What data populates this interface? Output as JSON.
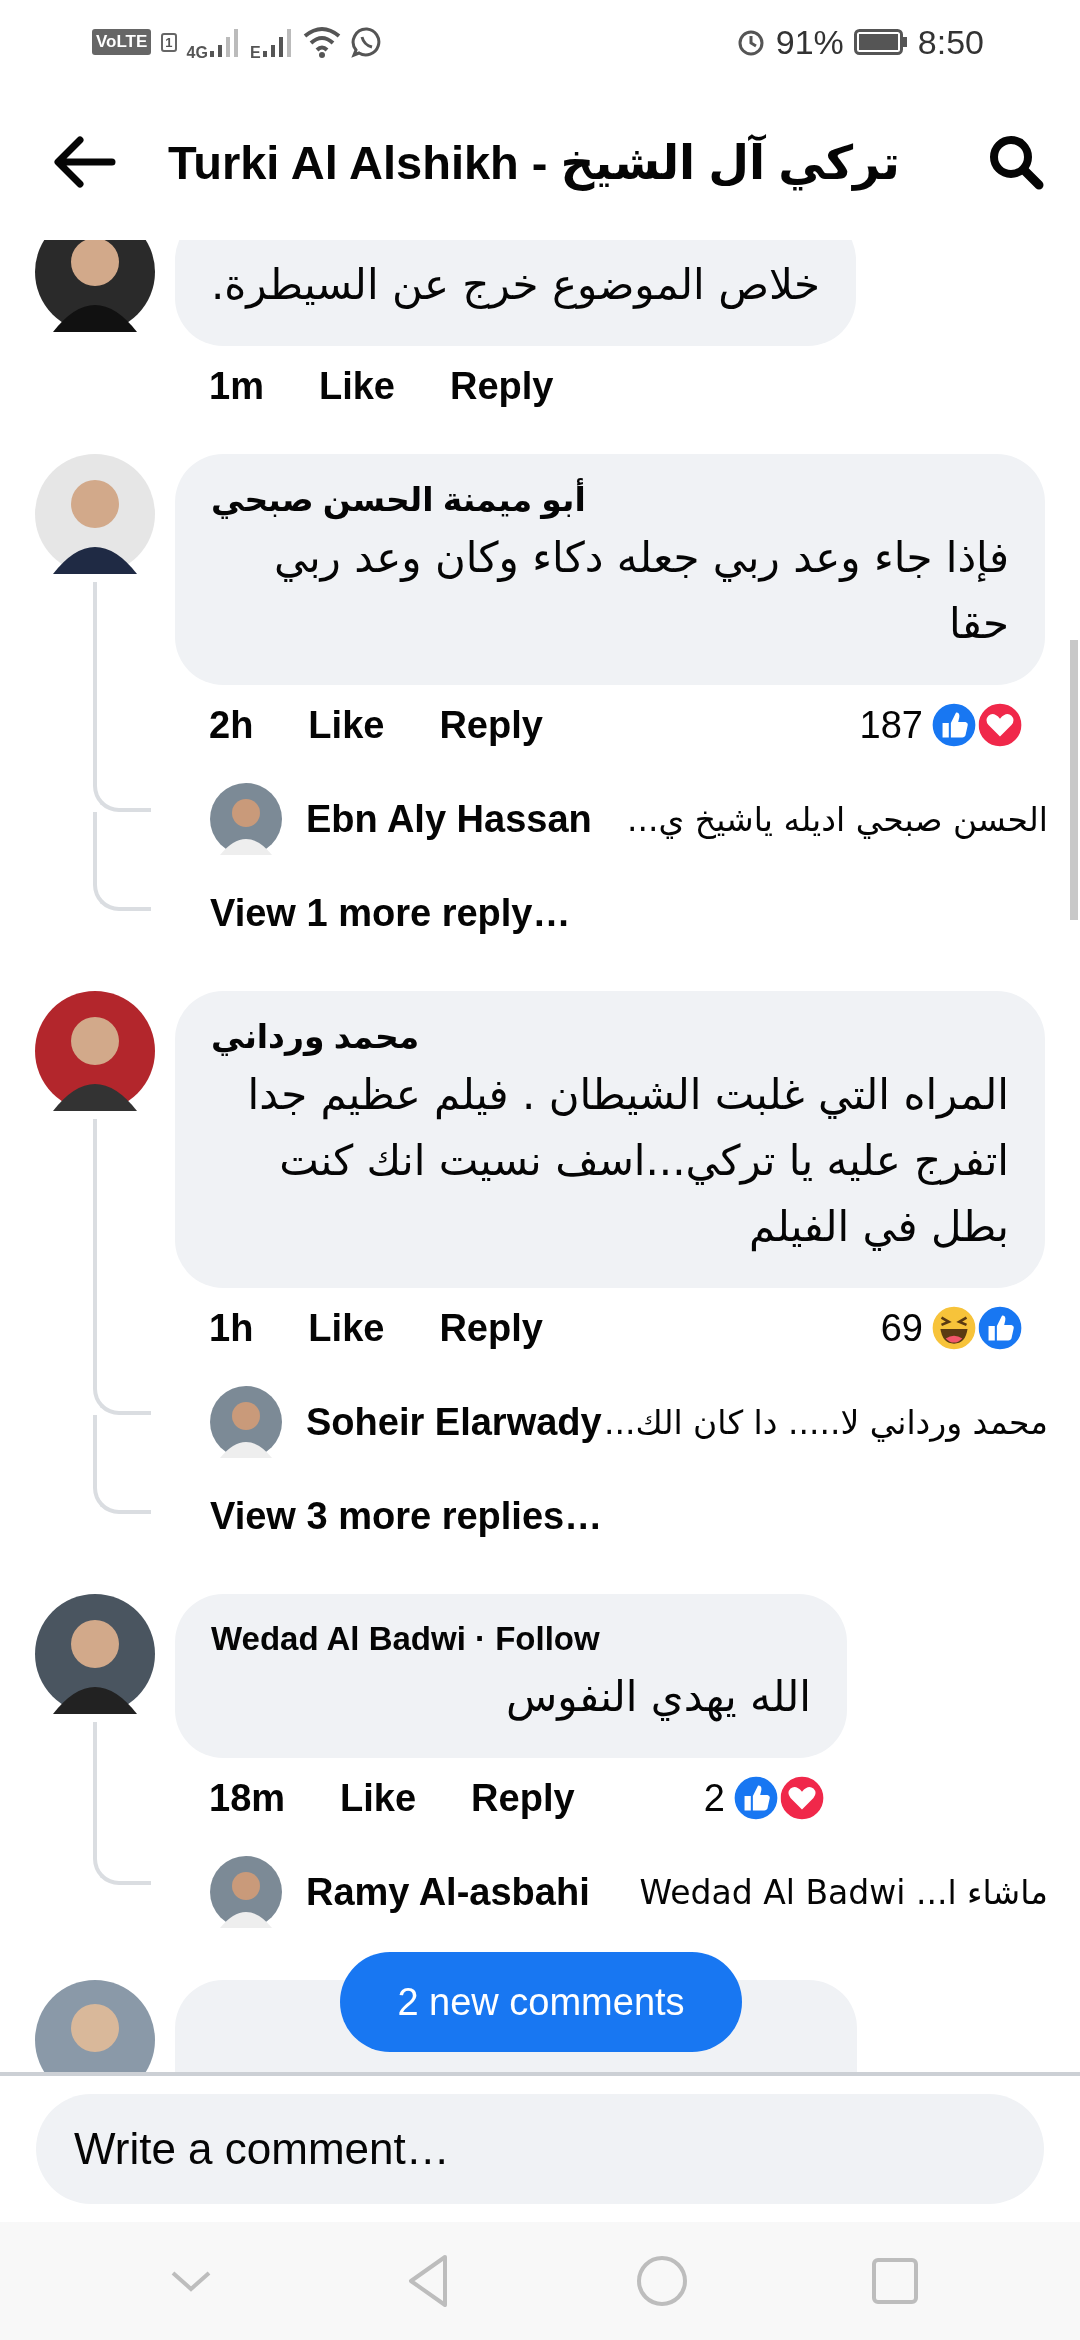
{
  "status_bar": {
    "volte": "VoLTE",
    "sim": "1",
    "network_1": "4G",
    "network_2": "E",
    "battery": "91%",
    "time": "8:50"
  },
  "header": {
    "title": "Turki Al Alshikh - تركي آل الشيخ"
  },
  "comments": [
    {
      "text": "خلاص الموضوع خرج عن السيطرة.",
      "time": "1m",
      "like": "Like",
      "reply": "Reply"
    },
    {
      "author": "أبو ميمنة الحسن صبحي",
      "text": "فإذا جاء وعد ربي جعله دكاء وكان وعد ربي حقا",
      "time": "2h",
      "like": "Like",
      "reply": "Reply",
      "reaction_count": "187",
      "reactions": [
        {
          "kind": "like"
        },
        {
          "kind": "love"
        }
      ],
      "replies": [
        {
          "author": "Ebn Aly Hassan",
          "text": "الحسن صبحي اديله ياشيخ ي..."
        }
      ],
      "more": "View 1 more reply…"
    },
    {
      "author": "محمد ورداني",
      "text": "المراه التي غلبت الشيطان .   فيلم عظيم جدا اتفرج عليه يا تركي...اسف نسيت انك كنت بطل في الفيلم",
      "time": "1h",
      "like": "Like",
      "reply": "Reply",
      "reaction_count": "69",
      "reactions": [
        {
          "kind": "haha"
        },
        {
          "kind": "like"
        }
      ],
      "replies": [
        {
          "author": "Soheir Elarwady",
          "text": "محمد ورداني لا..... دا كان الك..."
        }
      ],
      "more": "View 3 more replies…"
    },
    {
      "author": "Wedad Al Badwi · Follow",
      "text": "الله يهدي النفوس",
      "time": "18m",
      "like": "Like",
      "reply": "Reply",
      "reaction_count": "2",
      "reactions": [
        {
          "kind": "like"
        },
        {
          "kind": "love"
        }
      ],
      "replies": [
        {
          "author": "Ramy Al-asbahi",
          "text": "ماشاء ا... Wedad Al Badwi"
        }
      ]
    },
    {
      "cut_off": true
    }
  ],
  "new_comments_button": "2 new comments",
  "composer": {
    "placeholder": "Write a comment…"
  }
}
